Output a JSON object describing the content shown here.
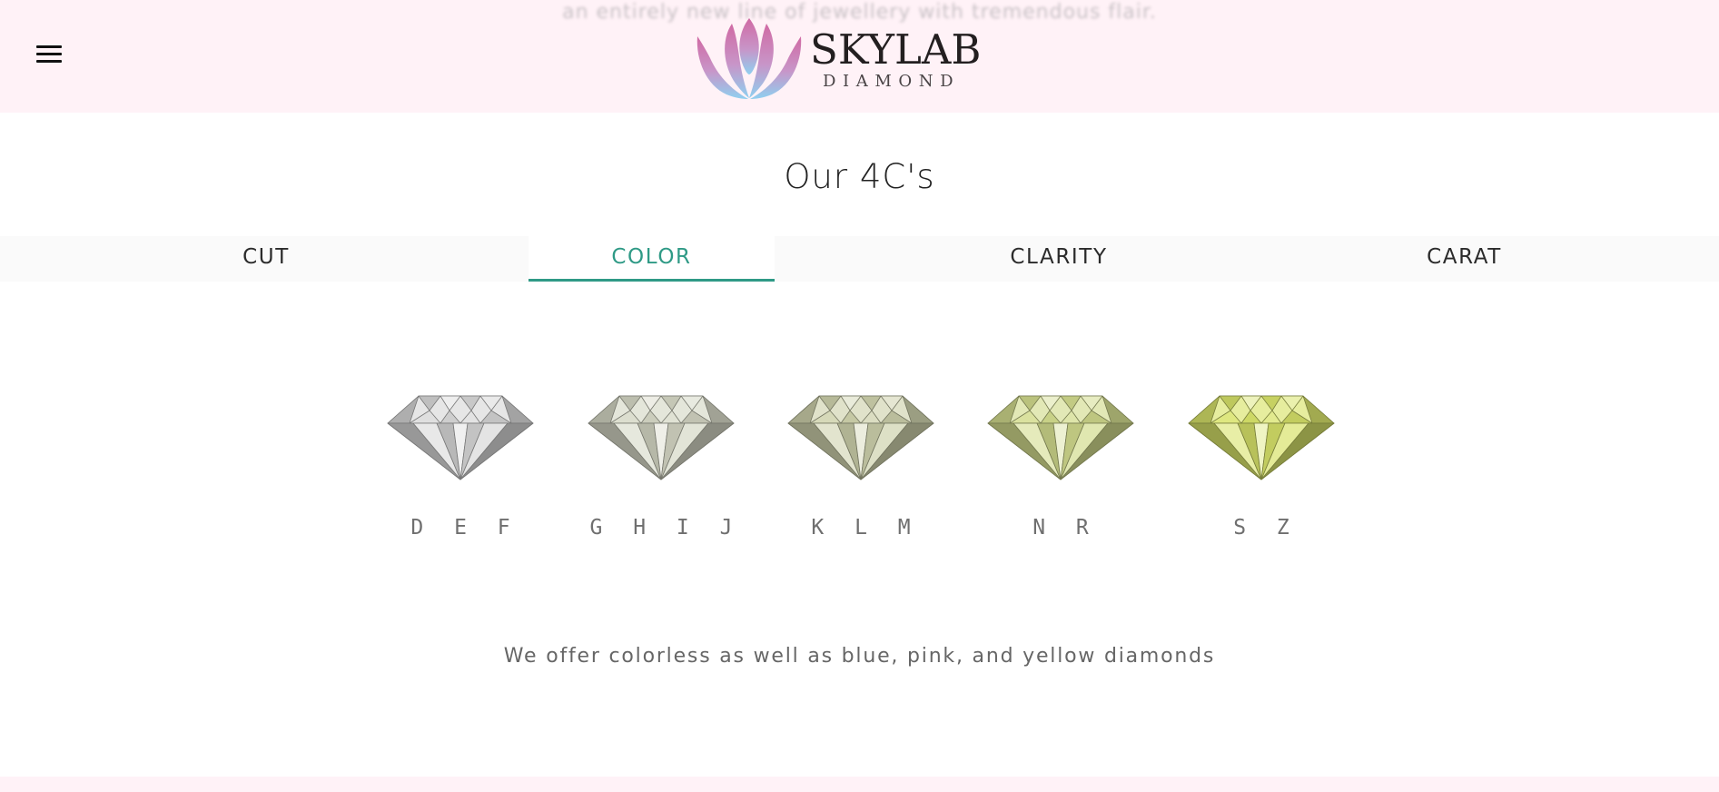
{
  "header": {
    "bleed_text": "an entirely new line of jewellery with tremendous flair.",
    "menu_icon": "hamburger-menu-icon",
    "logo": {
      "name": "SKYLAB",
      "subtitle": "DIAMOND",
      "mark_icon": "lotus-logo-icon"
    }
  },
  "section": {
    "title": "Our 4C's"
  },
  "tabs": [
    {
      "label": "CUT",
      "active": false
    },
    {
      "label": "COLOR",
      "active": true
    },
    {
      "label": "CLARITY",
      "active": false
    },
    {
      "label": "CARAT",
      "active": false
    }
  ],
  "color_grades": [
    {
      "label": "D E F",
      "tint": "#d9d9d9"
    },
    {
      "label": "G H I J",
      "tint": "#d6d8c6"
    },
    {
      "label": "K L M",
      "tint": "#cfd2ad"
    },
    {
      "label": "N R",
      "tint": "#d3dc8e"
    },
    {
      "label": "S Z",
      "tint": "#d8e36a"
    }
  ],
  "caption": "We offer colorless as well as blue, pink, and yellow diamonds",
  "colors": {
    "header_bg": "#fff2f7",
    "accent": "#2f9a86",
    "logo_pink": "#d06aa4",
    "logo_blue": "#8fd0f0"
  }
}
